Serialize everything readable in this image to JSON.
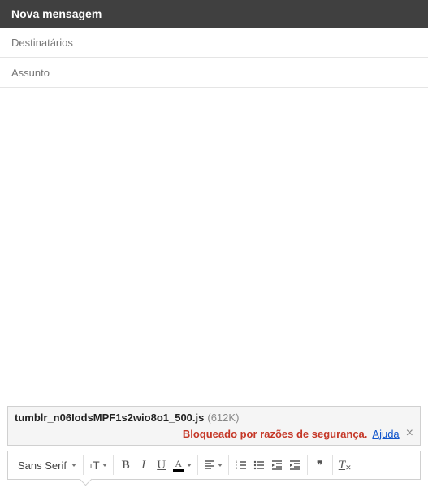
{
  "header": {
    "title": "Nova mensagem"
  },
  "fields": {
    "recipients_placeholder": "Destinatários",
    "subject_placeholder": "Assunto"
  },
  "body": "",
  "attachment": {
    "filename": "tumblr_n06IodsMPF1s2wio8o1_500.js",
    "size": "(612K)",
    "blocked_message": "Bloqueado por razões de segurança.",
    "help_label": "Ajuda"
  },
  "toolbar": {
    "font_name": "Sans Serif",
    "size_glyph": "тT",
    "bold": "B",
    "italic": "I",
    "underline": "U",
    "color_glyph": "A",
    "quote_glyph": "❝❞",
    "clear_glyph": "x"
  }
}
